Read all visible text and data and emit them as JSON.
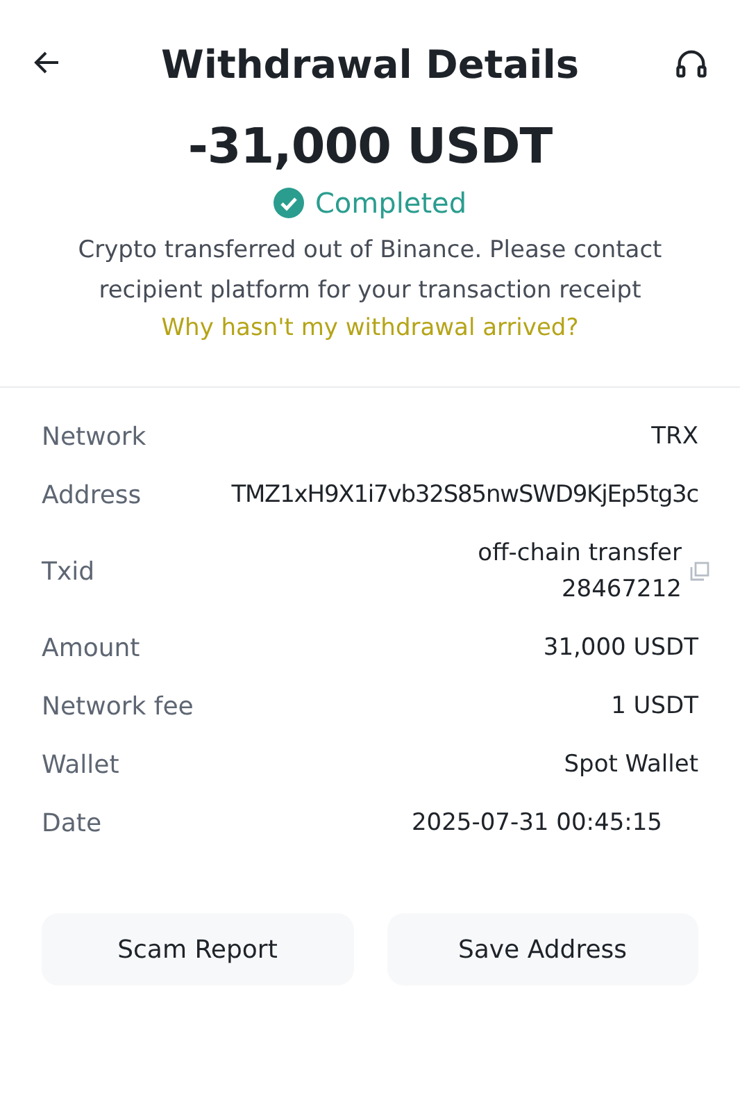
{
  "header": {
    "title": "Withdrawal Details"
  },
  "amount": "-31,000 USDT",
  "status": {
    "label": "Completed",
    "kind": "success"
  },
  "message": "Crypto transferred out of Binance. Please contact recipient platform for your transaction receipt",
  "help_link": "Why hasn't my withdrawal arrived?",
  "details": [
    {
      "label": "Network",
      "value": "TRX",
      "kind": "plain"
    },
    {
      "label": "Address",
      "value": "TMZ1xH9X1i7vb32S85nwSWD9KjEp5tg3c",
      "kind": "plain"
    },
    {
      "label": "Txid",
      "value": "off-chain transfer 28467212",
      "kind": "copy"
    },
    {
      "label": "Amount",
      "value": "31,000 USDT",
      "kind": "plain"
    },
    {
      "label": "Network fee",
      "value": "1 USDT",
      "kind": "plain"
    },
    {
      "label": "Wallet",
      "value": "Spot Wallet",
      "kind": "plain"
    },
    {
      "label": "Date",
      "value": "2025-07-31 00:45:15",
      "kind": "inset"
    }
  ],
  "buttons": [
    "Scam Report",
    "Save Address"
  ]
}
